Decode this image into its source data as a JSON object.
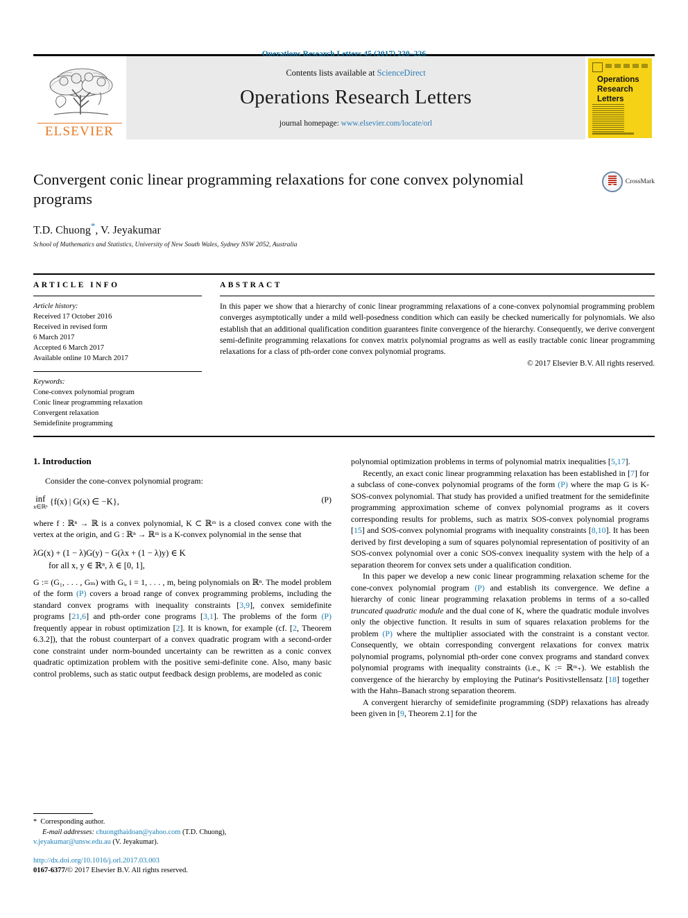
{
  "running_head": "Operations Research Letters 45 (2017) 220–226",
  "masthead": {
    "publisher_name": "ELSEVIER",
    "contents_prefix": "Contents lists available at ",
    "contents_link": "ScienceDirect",
    "journal_title": "Operations Research Letters",
    "homepage_prefix": "journal homepage: ",
    "homepage_url": "www.elsevier.com/locate/orl",
    "cover_title_line1": "Operations",
    "cover_title_line2": "Research",
    "cover_title_line3": "Letters"
  },
  "article": {
    "title": "Convergent conic linear programming relaxations for cone convex polynomial programs",
    "authors": "T.D. Chuong",
    "authors_tail": ", V. Jeyakumar",
    "corresponding_marker": "*",
    "affiliation": "School of Mathematics and Statistics, University of New South Wales, Sydney NSW 2052, Australia",
    "crossmark_label": "CrossMark"
  },
  "info": {
    "heading": "ARTICLE INFO",
    "history_label": "Article history:",
    "history": [
      "Received 17 October 2016",
      "Received in revised form",
      "6 March 2017",
      "Accepted 6 March 2017",
      "Available online 10 March 2017"
    ],
    "keywords_label": "Keywords:",
    "keywords": [
      "Cone-convex polynomial program",
      "Conic linear programming relaxation",
      "Convergent relaxation",
      "Semidefinite programming"
    ]
  },
  "abstract": {
    "heading": "ABSTRACT",
    "text": "In this paper we show that a hierarchy of conic linear programming relaxations of a cone-convex polynomial programming problem converges asymptotically under a mild well-posedness condition which can easily be checked numerically for polynomials. We also establish that an additional qualification condition guarantees finite convergence of the hierarchy. Consequently, we derive convergent semi-definite programming relaxations for convex matrix polynomial programs as well as easily tractable conic linear programming relaxations for a class of pth-order cone convex polynomial programs.",
    "copyright": "© 2017 Elsevier B.V. All rights reserved."
  },
  "body": {
    "section_number_title": "1. Introduction",
    "left": {
      "p1": "Consider the cone-convex polynomial program:",
      "eq_P_inf": "inf",
      "eq_P_sub": "x∈ℝⁿ",
      "eq_P_body": "{f(x) | G(x) ∈ −K},",
      "eq_P_tag": "(P)",
      "p2_a": "where f : ℝⁿ → ℝ is a convex polynomial, K ⊂ ℝᵐ is a closed convex cone with the vertex at the origin, and G : ℝⁿ → ℝᵐ is a K-convex polynomial in the sense that",
      "eq2_line1": "λG(x) + (1 − λ)G(y) − G(λx + (1 − λ)y) ∈ K",
      "eq2_line2": "for all x, y ∈ ℝⁿ, λ ∈ [0, 1],",
      "p3_1": "G := (G",
      "p3_full_a": "G := (G₁, . . . , G",
      "p3_full_b": ") with G",
      "p3_text": "G := (G₁, . . . , Gₘ) with Gᵢ, i = 1, . . . , m, being polynomials on ℝⁿ. The model problem of the form ",
      "p3_ref_P1": "(P)",
      "p3_text2": " covers a broad range of convex programming problems, including the standard convex programs with inequality constraints [",
      "p3_ref_39": "3,9",
      "p3_text3": "], convex semidefinite programs [",
      "p3_ref_216": "21,6",
      "p3_text4": "] and pth-order cone programs [",
      "p3_ref_31": "3,1",
      "p3_text5": "]. The problems of the form ",
      "p3_ref_P2": "(P)",
      "p3_text6": " frequently appear in robust optimization [",
      "p3_ref_2a": "2",
      "p3_text7": "]. It is known, for example (cf. [",
      "p3_ref_2b": "2",
      "p3_text8": ", Theorem 6.3.2]), that the robust counterpart of a convex quadratic program with a second-order cone constraint under norm-bounded uncertainty can be rewritten as a conic convex quadratic optimization problem with the positive semi-definite cone. Also, many basic control problems, such as static output feedback design problems, are modeled as conic"
    },
    "right": {
      "p1_a": "polynomial optimization problems in terms of polynomial matrix inequalities [",
      "p1_ref": "5,17",
      "p1_b": "].",
      "p2_a": "Recently, an exact conic linear programming relaxation has been established in [",
      "p2_ref7": "7",
      "p2_b": "] for a subclass of cone-convex polynomial programs of the form ",
      "p2_refP": "(P)",
      "p2_c": " where the map G is K-SOS-convex polynomial. That study has provided a unified treatment for the semidefinite programming approximation scheme of convex polynomial programs as it covers corresponding results for problems, such as matrix SOS-convex polynomial programs [",
      "p2_ref15": "15",
      "p2_d": "] and SOS-convex polynomial programs with inequality constraints [",
      "p2_ref810": "8,10",
      "p2_e": "]. It has been derived by first developing a sum of squares polynomial representation of positivity of an SOS-convex polynomial over a conic SOS-convex inequality system with the help of a separation theorem for convex sets under a qualification condition.",
      "p3_a": "In this paper we develop a new conic linear programming relaxation scheme for the cone-convex polynomial program ",
      "p3_refP1": "(P)",
      "p3_b": " and establish its convergence. We define a hierarchy of conic linear programming relaxation problems in terms of a so-called ",
      "p3_it": "truncated quadratic module",
      "p3_c": " and the dual cone of K, where the quadratic module involves only the objective function. It results in sum of squares relaxation problems for the problem ",
      "p3_refP2": "(P)",
      "p3_d": " where the multiplier associated with the constraint is a constant vector. Consequently, we obtain corresponding convergent relaxations for convex matrix polynomial programs, polynomial pth-order cone convex programs and standard convex polynomial programs with inequality constraints (i.e., K := ℝᵐ₊). We establish the convergence of the hierarchy by employing the Putinar's Positivstellensatz [",
      "p3_ref18": "18",
      "p3_e": "] together with the Hahn–Banach strong separation theorem.",
      "p4_a": "A convergent hierarchy of semidefinite programming (SDP) relaxations has already been given in [",
      "p4_ref9": "9",
      "p4_b": ", Theorem 2.1] for the"
    }
  },
  "footnote": {
    "star": "*",
    "corresponding": "Corresponding author.",
    "email_label": "E-mail addresses:",
    "email1": "chuongthaidoan@yahoo.com",
    "email1_owner": "(T.D. Chuong),",
    "email2": "v.jeyakumar@unsw.edu.au",
    "email2_owner": "(V. Jeyakumar).",
    "doi": "http://dx.doi.org/10.1016/j.orl.2017.03.003",
    "issn_prefix": "0167-6377/",
    "issn_rest": "© 2017 Elsevier B.V. All rights reserved."
  },
  "colors": {
    "link": "#1a7fb5",
    "running_head": "#0a6c9c",
    "elsevier_orange": "#E87722",
    "cover_yellow": "#F5D215",
    "masthead_gray": "#eaeaea"
  }
}
